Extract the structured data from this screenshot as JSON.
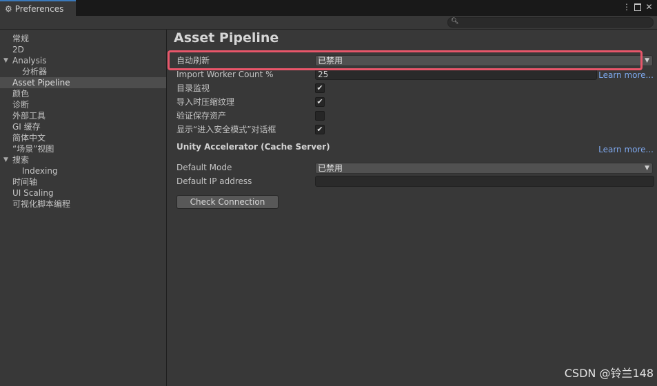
{
  "window": {
    "tab_title": "Preferences",
    "controls": {
      "more": "⋮",
      "close": "✕"
    }
  },
  "search": {
    "placeholder": "",
    "icon": "search-icon"
  },
  "sidebar": {
    "items": [
      {
        "label": "常规",
        "indent": 1,
        "selected": false
      },
      {
        "label": "2D",
        "indent": 1,
        "selected": false
      },
      {
        "label": "Analysis",
        "indent": 1,
        "selected": false,
        "expanded": true
      },
      {
        "label": "分析器",
        "indent": 2,
        "selected": false
      },
      {
        "label": "Asset Pipeline",
        "indent": 1,
        "selected": true
      },
      {
        "label": "颜色",
        "indent": 1,
        "selected": false
      },
      {
        "label": "诊断",
        "indent": 1,
        "selected": false
      },
      {
        "label": "外部工具",
        "indent": 1,
        "selected": false
      },
      {
        "label": "GI 缓存",
        "indent": 1,
        "selected": false
      },
      {
        "label": "简体中文",
        "indent": 1,
        "selected": false
      },
      {
        "label": "“场景”视图",
        "indent": 1,
        "selected": false
      },
      {
        "label": "搜索",
        "indent": 1,
        "selected": false,
        "expanded": true
      },
      {
        "label": "Indexing",
        "indent": 2,
        "selected": false
      },
      {
        "label": "时间轴",
        "indent": 1,
        "selected": false
      },
      {
        "label": "UI Scaling",
        "indent": 1,
        "selected": false
      },
      {
        "label": "可视化脚本编程",
        "indent": 1,
        "selected": false
      }
    ]
  },
  "main": {
    "title": "Asset Pipeline",
    "auto_refresh": {
      "label": "自动刷新",
      "value": "已禁用"
    },
    "import_worker": {
      "label": "Import Worker Count %",
      "value": "25",
      "link": "Learn more..."
    },
    "dir_monitor": {
      "label": "目录监视",
      "checked": true
    },
    "compress_textures": {
      "label": "导入时压缩纹理",
      "checked": true
    },
    "verify_saving": {
      "label": "验证保存资产",
      "checked": false
    },
    "safe_mode_dialog": {
      "label": "显示“进入安全模式”对话框",
      "checked": true
    },
    "accelerator": {
      "header": "Unity Accelerator (Cache Server)",
      "link": "Learn more...",
      "default_mode": {
        "label": "Default Mode",
        "value": "已禁用"
      },
      "default_ip": {
        "label": "Default IP address",
        "value": ""
      },
      "check_button": "Check Connection"
    }
  },
  "watermark": "CSDN @铃兰148",
  "colors": {
    "background": "#383838",
    "titlebar": "#191919",
    "accent_tab": "#3a79bb",
    "link": "#7ea7ec",
    "highlight": "#e8566a"
  }
}
